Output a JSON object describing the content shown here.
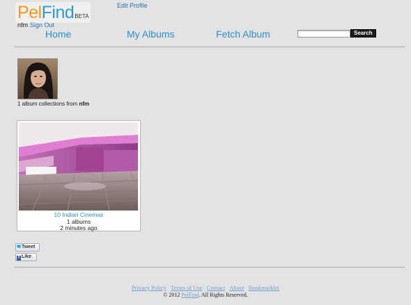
{
  "brand": {
    "part1": "Pel",
    "part2": "Find",
    "badge": "BETA"
  },
  "header": {
    "edit_profile": "Edit Profile",
    "username": "nfm",
    "sign_out": "Sign Out",
    "colors": {
      "logo_orange": "#f39a1f",
      "logo_blue": "#2b9ad7",
      "link": "#2470b8"
    }
  },
  "nav": {
    "home": "Home",
    "my_albums": "My Albums",
    "fetch_album": "Fetch Album"
  },
  "search": {
    "placeholder": "",
    "button": "Search"
  },
  "profile": {
    "collections_text": "1 album collections from",
    "username": "nfm"
  },
  "album": {
    "title": "10 Indian Cinemas",
    "count": "1 albums",
    "time": "2 minutes ago"
  },
  "social": {
    "tweet": "Tweet",
    "like": "Like"
  },
  "footer": {
    "links": [
      "Privacy Policy",
      "Terms of Use",
      "Contact",
      "About",
      "Bookmarklet"
    ],
    "copyright_pre": "© 2012",
    "copyright_brand": "PelFind",
    "copyright_post": ". All Rights Reserved."
  }
}
